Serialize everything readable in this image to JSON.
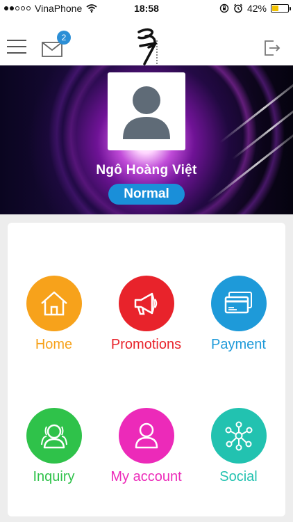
{
  "status_bar": {
    "carrier": "VinaPhone",
    "time": "18:58",
    "battery": "42%",
    "battery_level": 0.42
  },
  "nav": {
    "mail_count": "2"
  },
  "profile": {
    "name": "Ngô Hoàng Việt",
    "level": "Normal"
  },
  "menu": [
    {
      "label": "Home",
      "icon": "home-icon",
      "color": "#f7a21b"
    },
    {
      "label": "Promotions",
      "icon": "megaphone-icon",
      "color": "#e8232b"
    },
    {
      "label": "Payment",
      "icon": "credit-card-icon",
      "color": "#1e9ad9"
    },
    {
      "label": "Inquiry",
      "icon": "users-icon",
      "color": "#2fc24a"
    },
    {
      "label": "My account",
      "icon": "user-icon",
      "color": "#ec2ab9"
    },
    {
      "label": "Social",
      "icon": "network-icon",
      "color": "#22c2b0"
    }
  ]
}
